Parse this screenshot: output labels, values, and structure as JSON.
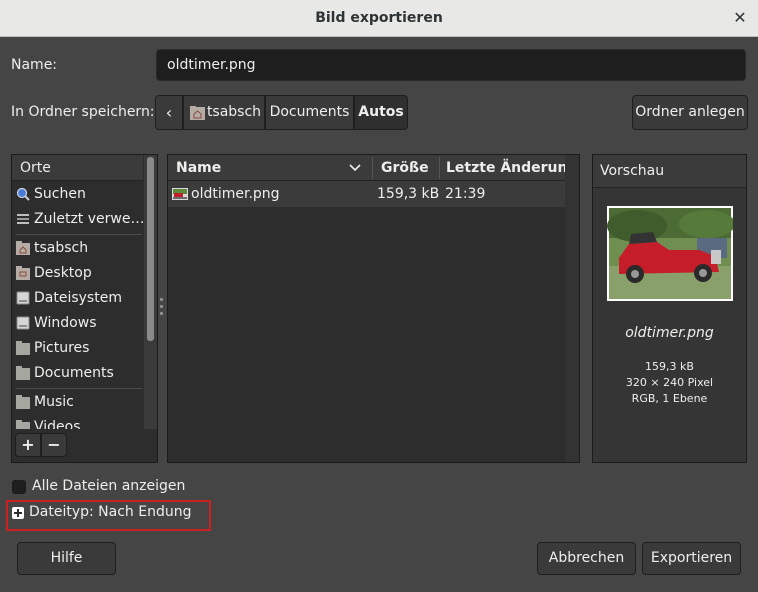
{
  "window": {
    "title": "Bild exportieren"
  },
  "name_field": {
    "label": "Name:",
    "value": "oldtimer.png"
  },
  "save_in": {
    "label": "In Ordner speichern:",
    "path": [
      "tsabsch",
      "Documents",
      "Autos"
    ],
    "create_folder": "Ordner anlegen"
  },
  "places": {
    "header": "Orte",
    "items": [
      {
        "label": "Suchen",
        "icon": "search-icon"
      },
      {
        "label": "Zuletzt verwe…",
        "icon": "recent-icon"
      },
      {
        "label": "tsabsch",
        "icon": "home-folder-icon"
      },
      {
        "label": "Desktop",
        "icon": "desktop-folder-icon"
      },
      {
        "label": "Dateisystem",
        "icon": "drive-icon"
      },
      {
        "label": "Windows",
        "icon": "drive-icon"
      },
      {
        "label": "Pictures",
        "icon": "folder-icon"
      },
      {
        "label": "Documents",
        "icon": "folder-icon"
      },
      {
        "label": "Music",
        "icon": "folder-icon"
      },
      {
        "label": "Videos",
        "icon": "folder-icon"
      }
    ],
    "add_symbol": "+",
    "remove_symbol": "−"
  },
  "files": {
    "columns": {
      "name": "Name",
      "size": "Größe",
      "modified": "Letzte Änderung"
    },
    "rows": [
      {
        "name": "oldtimer.png",
        "size": "159,3 kB",
        "modified": "21:39"
      }
    ]
  },
  "preview": {
    "header": "Vorschau",
    "filename": "oldtimer.png",
    "size": "159,3 kB",
    "dimensions": "320 × 240 Pixel",
    "mode": "RGB, 1 Ebene"
  },
  "options": {
    "show_all": "Alle Dateien anzeigen",
    "show_all_checked": false,
    "filetype": "Dateityp: Nach Endung"
  },
  "buttons": {
    "help": "Hilfe",
    "cancel": "Abbrechen",
    "export": "Exportieren"
  },
  "colors": {
    "highlight_box": "#cc1f1f",
    "selected_row": "#3b3b3b"
  }
}
